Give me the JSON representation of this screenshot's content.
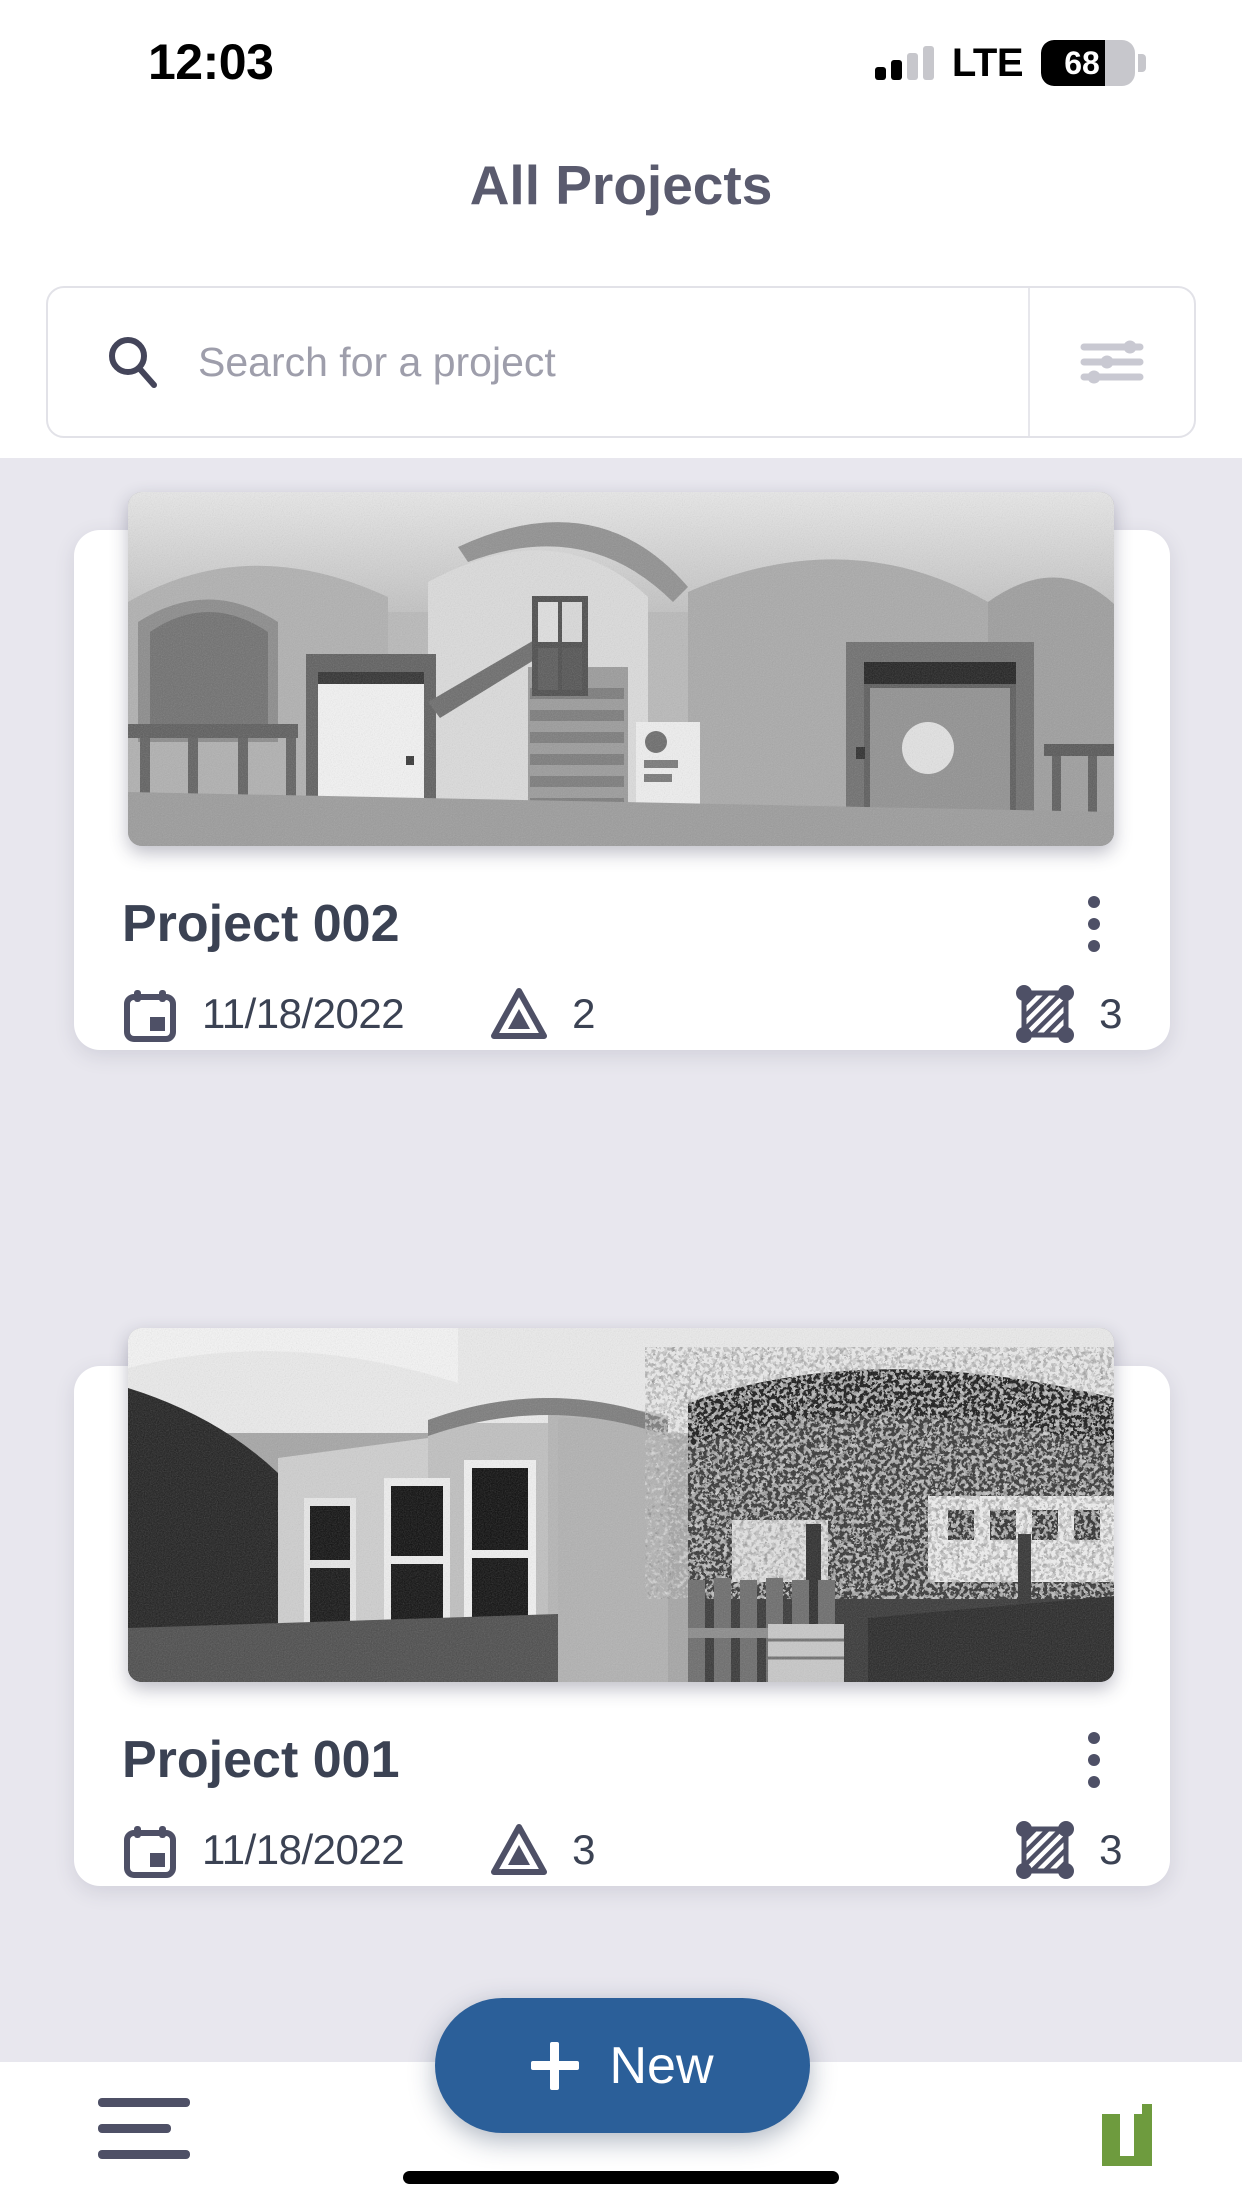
{
  "status_bar": {
    "time": "12:03",
    "network_label": "LTE",
    "signal_bars_total": 4,
    "signal_bars_filled": 2,
    "battery_percent": "68",
    "battery_level": 68
  },
  "header": {
    "title": "All Projects"
  },
  "search": {
    "placeholder": "Search for a project",
    "value": "",
    "search_icon": "search-icon",
    "filter_icon": "filter-sliders-icon"
  },
  "projects": [
    {
      "title": "Project 002",
      "date": "11/18/2022",
      "date_icon": "calendar-icon",
      "warnings_count": "2",
      "warnings_icon": "warning-triangle-icon",
      "areas_count": "3",
      "areas_icon": "scan-area-icon",
      "menu_icon": "kebab-menu-icon",
      "thumbnail_alt": "interior-pointcloud-panorama"
    },
    {
      "title": "Project 001",
      "date": "11/18/2022",
      "date_icon": "calendar-icon",
      "warnings_count": "3",
      "warnings_icon": "warning-triangle-icon",
      "areas_count": "3",
      "areas_icon": "scan-area-icon",
      "menu_icon": "kebab-menu-icon",
      "thumbnail_alt": "exterior-pointcloud-panorama"
    }
  ],
  "fab": {
    "label": "New",
    "icon": "plus-icon"
  },
  "bottom_bar": {
    "menu_icon": "hamburger-menu-icon",
    "brand_icon": "brand-logo-icon"
  },
  "colors": {
    "accent_blue": "#2b5f99",
    "brand_green": "#6e9b3e",
    "page_background": "#e8e7ee",
    "title_slate": "#5a5b6e",
    "text_dark": "#3b4253",
    "placeholder_gray": "#9e9eab"
  }
}
